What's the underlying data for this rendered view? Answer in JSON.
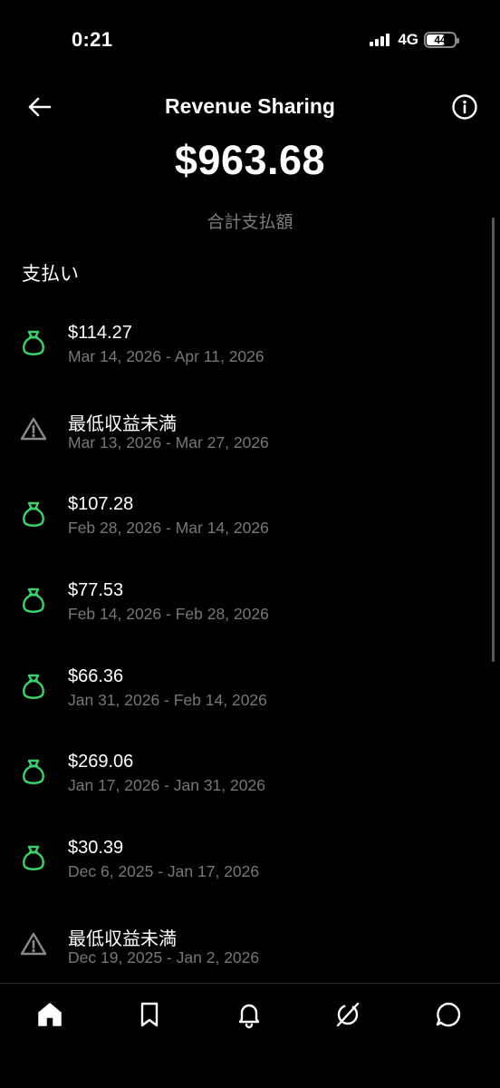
{
  "status_bar": {
    "time": "0:21",
    "network": "4G",
    "battery": "44"
  },
  "header": {
    "title": "Revenue Sharing",
    "back_icon": "arrow-left-icon",
    "info_icon": "info-icon"
  },
  "summary": {
    "total_amount": "$963.68",
    "total_label": "合計支払額"
  },
  "payouts": {
    "section_title": "支払い",
    "items": [
      {
        "label": "$114.27",
        "dates": "Mar 14, 2026 - Apr 11, 2026",
        "type": "paid",
        "icon": "money-bag-icon"
      },
      {
        "label": "最低収益未満",
        "dates": "Mar 13, 2026 - Mar 27, 2026",
        "type": "below-minimum",
        "icon": "warning-icon"
      },
      {
        "label": "$107.28",
        "dates": "Feb 28, 2026 - Mar 14, 2026",
        "type": "paid",
        "icon": "money-bag-icon"
      },
      {
        "label": "$77.53",
        "dates": "Feb 14, 2026 - Feb 28, 2026",
        "type": "paid",
        "icon": "money-bag-icon"
      },
      {
        "label": "$66.36",
        "dates": "Jan 31, 2026 - Feb 14, 2026",
        "type": "paid",
        "icon": "money-bag-icon"
      },
      {
        "label": "$269.06",
        "dates": "Jan 17, 2026 - Jan 31, 2026",
        "type": "paid",
        "icon": "money-bag-icon"
      },
      {
        "label": "$30.39",
        "dates": "Dec 6, 2025 - Jan 17, 2026",
        "type": "paid",
        "icon": "money-bag-icon"
      },
      {
        "label": "最低収益未満",
        "dates": "Dec 19, 2025 - Jan 2, 2026",
        "type": "below-minimum",
        "icon": "warning-icon"
      }
    ]
  },
  "bottom_nav": {
    "items": [
      {
        "icon": "home-icon"
      },
      {
        "icon": "bookmark-icon"
      },
      {
        "icon": "bell-icon"
      },
      {
        "icon": "grok-icon"
      },
      {
        "icon": "chat-bubble-icon"
      }
    ]
  },
  "colors": {
    "background": "#000000",
    "text_primary": "#ffffff",
    "text_secondary": "#777777",
    "paid_icon": "#3ecf6e",
    "warning_icon": "#8a8a8a"
  }
}
